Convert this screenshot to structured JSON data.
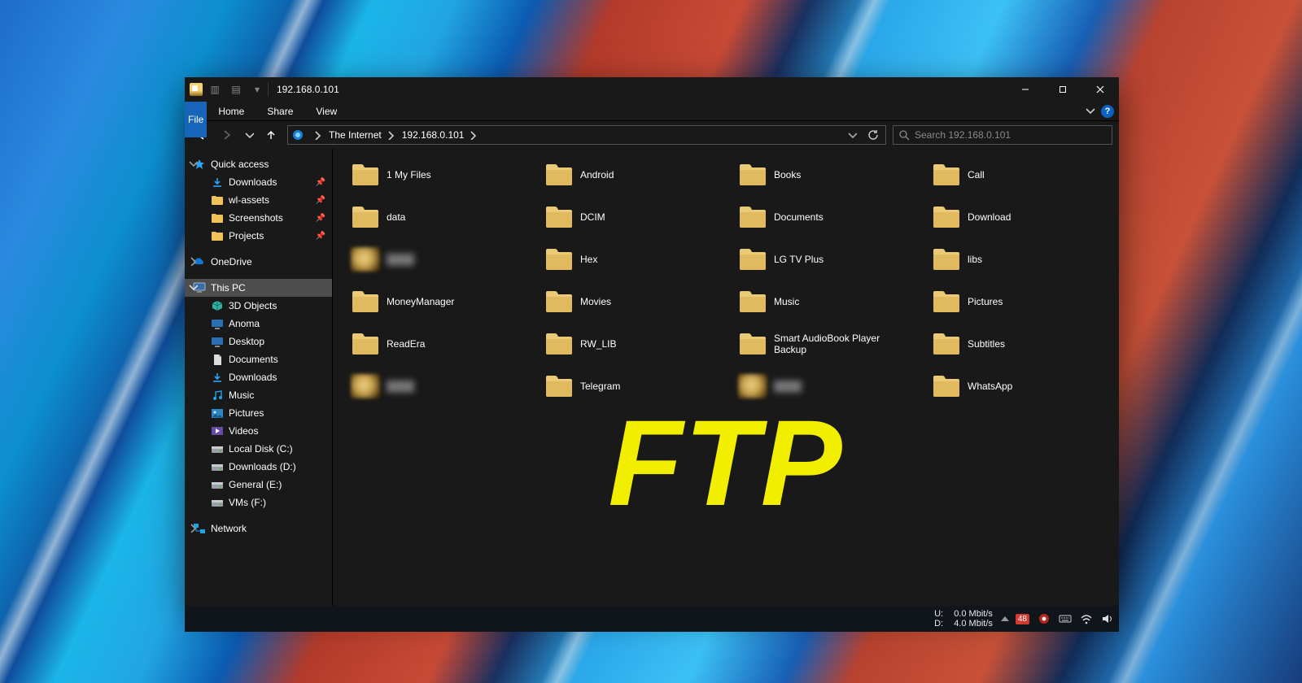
{
  "window": {
    "title": "192.168.0.101",
    "tabs": {
      "file": "File",
      "home": "Home",
      "share": "Share",
      "view": "View"
    }
  },
  "address": {
    "root": "The Internet",
    "current": "192.168.0.101"
  },
  "search": {
    "placeholder": "Search 192.168.0.101"
  },
  "nav": {
    "quick_access": "Quick access",
    "quick_items": [
      {
        "label": "Downloads",
        "icon": "download",
        "pinned": true
      },
      {
        "label": "wl-assets",
        "icon": "folder",
        "pinned": true
      },
      {
        "label": "Screenshots",
        "icon": "folder",
        "pinned": true
      },
      {
        "label": "Projects",
        "icon": "folder",
        "pinned": true
      }
    ],
    "onedrive": "OneDrive",
    "this_pc": "This PC",
    "pc_items": [
      {
        "label": "3D Objects",
        "icon": "3d"
      },
      {
        "label": "Anoma",
        "icon": "desktop"
      },
      {
        "label": "Desktop",
        "icon": "desktop"
      },
      {
        "label": "Documents",
        "icon": "documents"
      },
      {
        "label": "Downloads",
        "icon": "download"
      },
      {
        "label": "Music",
        "icon": "music"
      },
      {
        "label": "Pictures",
        "icon": "pictures"
      },
      {
        "label": "Videos",
        "icon": "videos"
      },
      {
        "label": "Local Disk (C:)",
        "icon": "disk"
      },
      {
        "label": "Downloads (D:)",
        "icon": "disk"
      },
      {
        "label": "General (E:)",
        "icon": "disk"
      },
      {
        "label": "VMs (F:)",
        "icon": "disk"
      }
    ],
    "network": "Network"
  },
  "files": [
    {
      "label": "1 My Files"
    },
    {
      "label": "Android"
    },
    {
      "label": "Books"
    },
    {
      "label": "Call"
    },
    {
      "label": "data"
    },
    {
      "label": "DCIM"
    },
    {
      "label": "Documents"
    },
    {
      "label": "Download"
    },
    {
      "label": "",
      "blurred": true
    },
    {
      "label": "Hex"
    },
    {
      "label": "LG TV Plus"
    },
    {
      "label": "libs"
    },
    {
      "label": "MoneyManager"
    },
    {
      "label": "Movies"
    },
    {
      "label": "Music"
    },
    {
      "label": "Pictures"
    },
    {
      "label": "ReadEra"
    },
    {
      "label": "RW_LIB"
    },
    {
      "label": "Smart AudioBook Player Backup"
    },
    {
      "label": "Subtitles"
    },
    {
      "label": "",
      "blurred": true
    },
    {
      "label": "Telegram"
    },
    {
      "label": "",
      "blurred": true
    },
    {
      "label": "WhatsApp"
    }
  ],
  "overlay": "FTP",
  "taskbar": {
    "up_label": "U:",
    "up_value": "0.0 Mbit/s",
    "dn_label": "D:",
    "dn_value": "4.0 Mbit/s",
    "badge": "48"
  }
}
